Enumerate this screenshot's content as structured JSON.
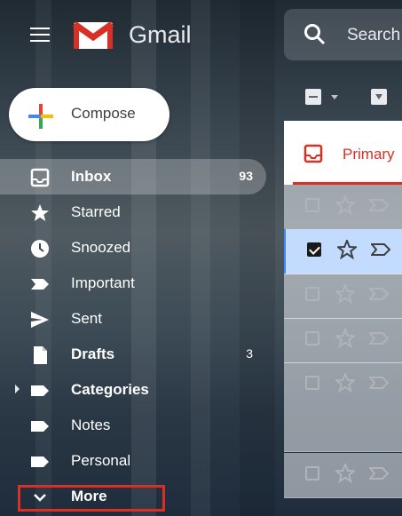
{
  "header": {
    "app_name": "Gmail",
    "search_placeholder": "Search"
  },
  "compose": {
    "label": "Compose"
  },
  "sidebar": {
    "items": [
      {
        "label": "Inbox",
        "count": "93",
        "icon": "inbox-icon",
        "bold": true,
        "active": true
      },
      {
        "label": "Starred",
        "count": "",
        "icon": "star-icon",
        "bold": false
      },
      {
        "label": "Snoozed",
        "count": "",
        "icon": "clock-icon",
        "bold": false
      },
      {
        "label": "Important",
        "count": "",
        "icon": "important-icon",
        "bold": false
      },
      {
        "label": "Sent",
        "count": "",
        "icon": "send-icon",
        "bold": false
      },
      {
        "label": "Drafts",
        "count": "3",
        "icon": "draft-icon",
        "bold": true
      },
      {
        "label": "Categories",
        "count": "",
        "icon": "label-icon",
        "bold": true
      },
      {
        "label": "Notes",
        "count": "",
        "icon": "label-icon",
        "bold": false
      },
      {
        "label": "Personal",
        "count": "",
        "icon": "label-icon",
        "bold": false
      },
      {
        "label": "More",
        "count": "",
        "icon": "chevron-down-icon",
        "bold": true
      }
    ]
  },
  "email_panel": {
    "tab_primary": "Primary",
    "rows": [
      {
        "checked": false
      },
      {
        "checked": true
      },
      {
        "checked": false
      },
      {
        "checked": false
      },
      {
        "checked": false
      },
      {
        "checked": false
      }
    ]
  },
  "colors": {
    "accent_red": "#d93025",
    "selected_row": "#c2dbff"
  }
}
